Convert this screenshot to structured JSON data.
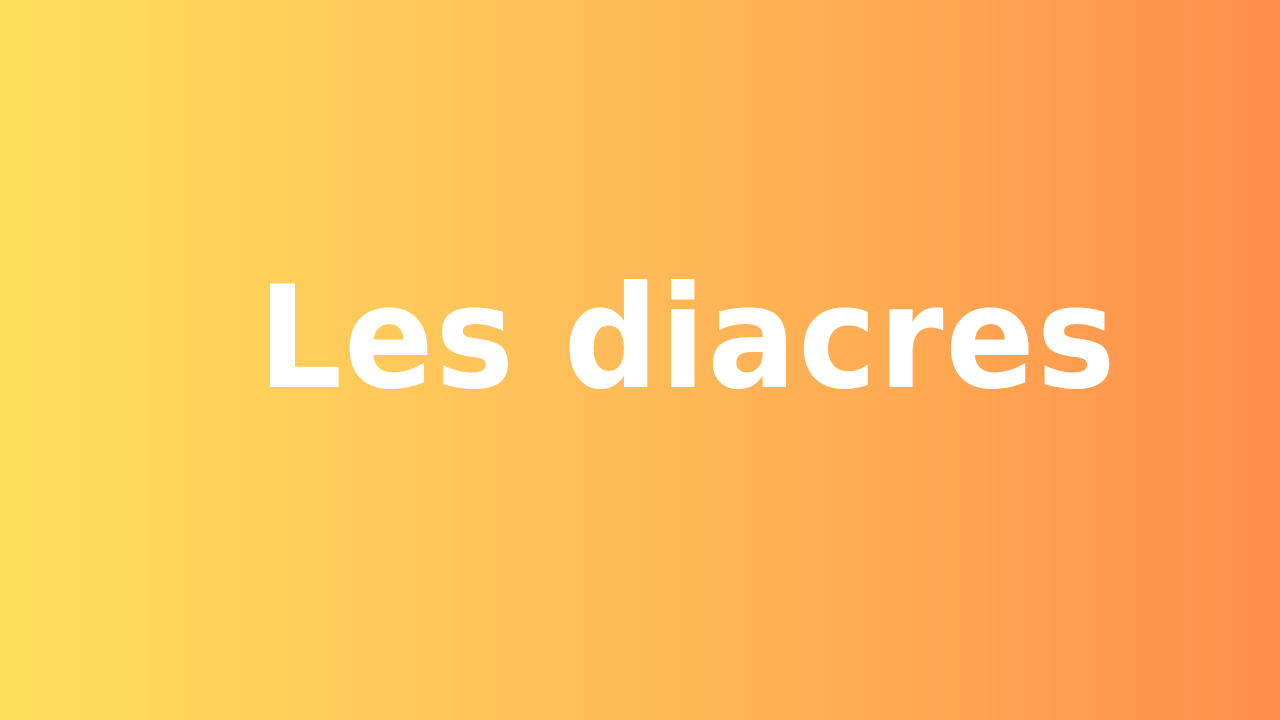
{
  "slide": {
    "title": "Les diacres",
    "background_gradient": {
      "start": "#FFDF5A",
      "end": "#FF8E4C"
    },
    "text_color": "#FFFFFF"
  }
}
